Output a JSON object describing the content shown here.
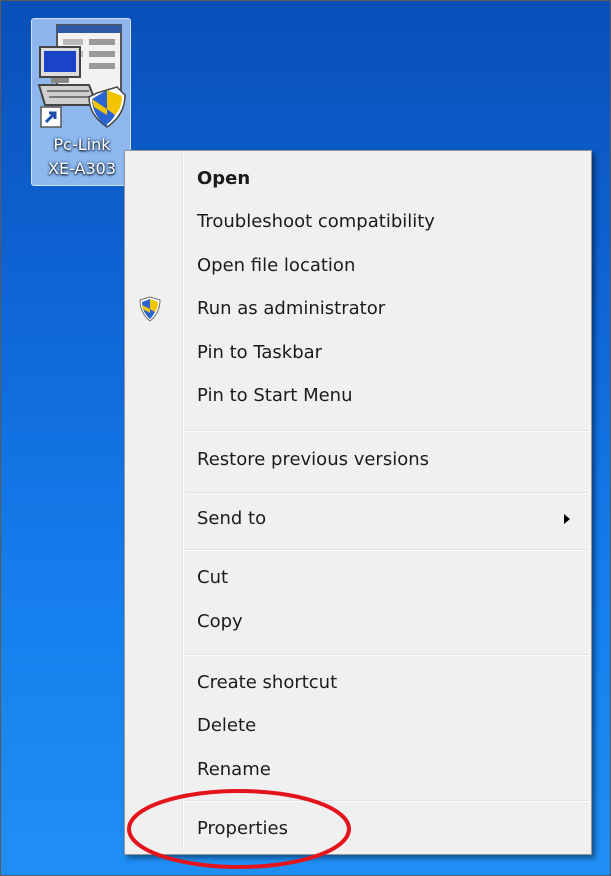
{
  "desktop_icon": {
    "label_line1": "Pc-Link",
    "label_line2": "XE-A303",
    "icon": "shortcut-app-icon",
    "overlays": [
      "shortcut-arrow-icon",
      "uac-shield-icon"
    ]
  },
  "context_menu": {
    "items": [
      {
        "label": "Open",
        "bold": true
      },
      {
        "label": "Troubleshoot compatibility"
      },
      {
        "label": "Open file location"
      },
      {
        "label": "Run as administrator",
        "icon": "uac-shield-icon"
      },
      {
        "label": "Pin to Taskbar"
      },
      {
        "label": "Pin to Start Menu"
      },
      {
        "label": "Restore previous versions"
      },
      {
        "label": "Send to",
        "submenu": true
      },
      {
        "label": "Cut"
      },
      {
        "label": "Copy"
      },
      {
        "label": "Create shortcut"
      },
      {
        "label": "Delete"
      },
      {
        "label": "Rename"
      },
      {
        "label": "Properties",
        "highlighted": true
      }
    ]
  },
  "colors": {
    "desktop_background": "#1168d8",
    "menu_background": "#f0f0f0",
    "highlight_ring": "#e3141b"
  }
}
